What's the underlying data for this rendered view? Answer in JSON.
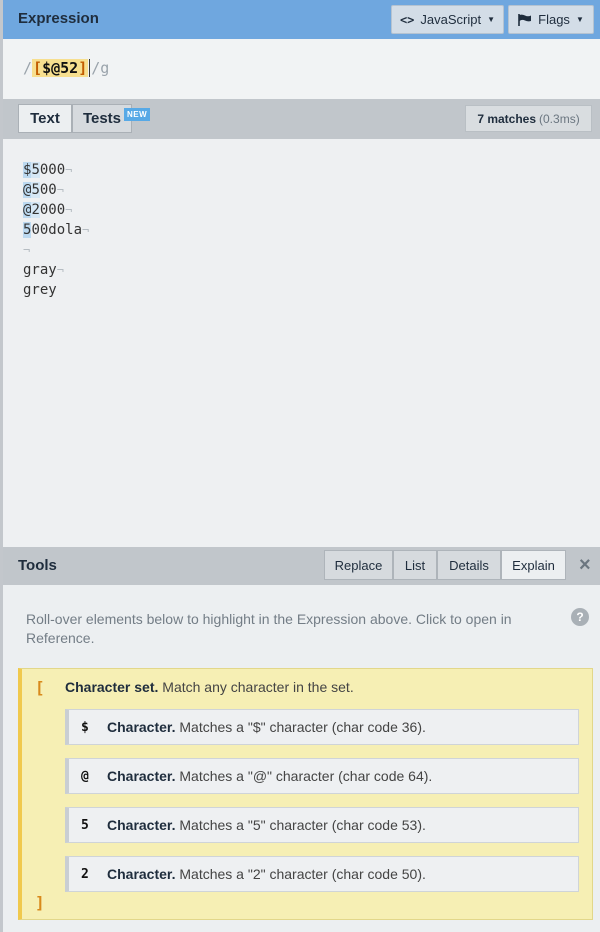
{
  "expression": {
    "title": "Expression",
    "flavor_label": "JavaScript",
    "flags_label": "Flags",
    "open_delim": "/",
    "set_open": "[",
    "set_chars": "$@52",
    "set_close": "]",
    "close_delim": "/",
    "flags": "g"
  },
  "text_tabs": {
    "text_label": "Text",
    "tests_label": "Tests",
    "new_badge": "NEW",
    "match_count": "7 matches",
    "match_time": "(0.3ms)"
  },
  "text_lines": [
    {
      "match": "$5",
      "rest": "000",
      "eol": "¬"
    },
    {
      "match": "@5",
      "rest": "00",
      "eol": "¬"
    },
    {
      "match": "@2",
      "rest": "000",
      "eol": "¬"
    },
    {
      "match": "5",
      "rest": "00dola",
      "eol": "¬"
    },
    {
      "match": "",
      "rest": "",
      "eol": "¬"
    },
    {
      "match": "",
      "rest": "gray",
      "eol": "¬"
    },
    {
      "match": "",
      "rest": "grey",
      "eol": ""
    }
  ],
  "tools": {
    "title": "Tools",
    "tabs": [
      "Replace",
      "List",
      "Details",
      "Explain"
    ],
    "close": "×",
    "hint": "Roll-over elements below to highlight in the Expression above. Click to open in Reference.",
    "help": "?"
  },
  "explain": {
    "open": "[",
    "close": "]",
    "set_title": "Character set.",
    "set_text": "Match any character in the set.",
    "items": [
      {
        "sym": "$",
        "title": "Character.",
        "text": "Matches a \"$\" character (char code 36)."
      },
      {
        "sym": "@",
        "title": "Character.",
        "text": "Matches a \"@\" character (char code 64)."
      },
      {
        "sym": "5",
        "title": "Character.",
        "text": "Matches a \"5\" character (char code 53)."
      },
      {
        "sym": "2",
        "title": "Character.",
        "text": "Matches a \"2\" character (char code 50)."
      }
    ]
  }
}
